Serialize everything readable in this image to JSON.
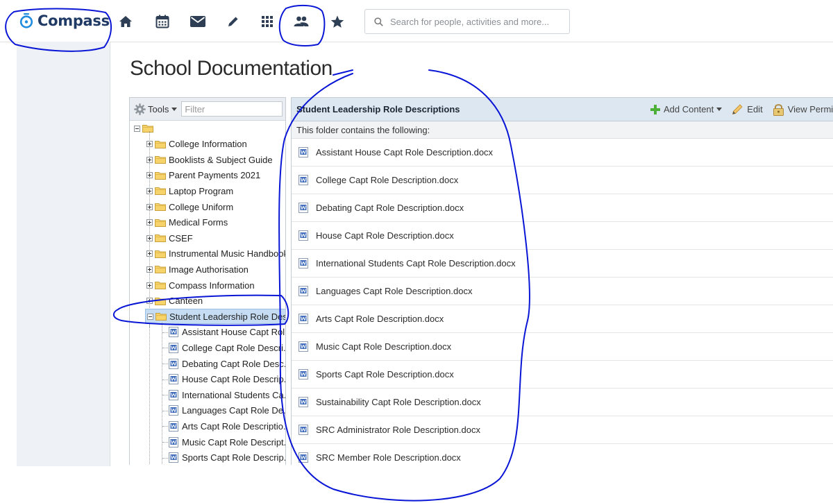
{
  "app": {
    "brand": "Compass"
  },
  "nav": {
    "icons": [
      "home-icon",
      "calendar-icon",
      "mail-icon",
      "pencil-icon",
      "apps-grid-icon",
      "people-icon",
      "star-icon"
    ],
    "search_placeholder": "Search for people, activities and more..."
  },
  "page": {
    "title": "School Documentation"
  },
  "tree": {
    "tools_label": "Tools",
    "filter_placeholder": "Filter",
    "folders": [
      "College Information",
      "Booklists & Subject Guide",
      "Parent Payments 2021",
      "Laptop Program",
      "College Uniform",
      "Medical Forms",
      "CSEF",
      "Instrumental Music Handbook",
      "Image Authorisation",
      "Compass Information",
      "Canteen"
    ],
    "selected_folder": "Student Leadership Role Des...",
    "children": [
      "Assistant House Capt Rol...",
      "College Capt Role Descri...",
      "Debating Capt Role Desc...",
      "House Capt Role Descrip...",
      "International Students Ca...",
      "Languages Capt Role De...",
      "Arts Capt Role Descriptio...",
      "Music Capt Role Descript...",
      "Sports Capt Role Descrip..."
    ]
  },
  "content": {
    "title": "Student Leadership Role Descriptions",
    "add_content": "Add Content",
    "edit": "Edit",
    "view_permissions": "View Permiss",
    "subheader": "This folder contains the following:",
    "files": [
      "Assistant House Capt Role Description.docx",
      "College Capt Role Description.docx",
      "Debating Capt Role Description.docx",
      "House Capt Role Description.docx",
      "International Students Capt Role Description.docx",
      "Languages Capt Role Description.docx",
      "Arts Capt Role Description.docx",
      "Music Capt Role Description.docx",
      "Sports Capt Role Description.docx",
      "Sustainability Capt Role Description.docx",
      "SRC Administrator Role Description.docx",
      "SRC Member Role Description.docx"
    ]
  },
  "colors": {
    "brand": "#203a66",
    "annotation": "#0a16d6",
    "selection": "#c5dcf2",
    "header": "#dde7f1"
  }
}
